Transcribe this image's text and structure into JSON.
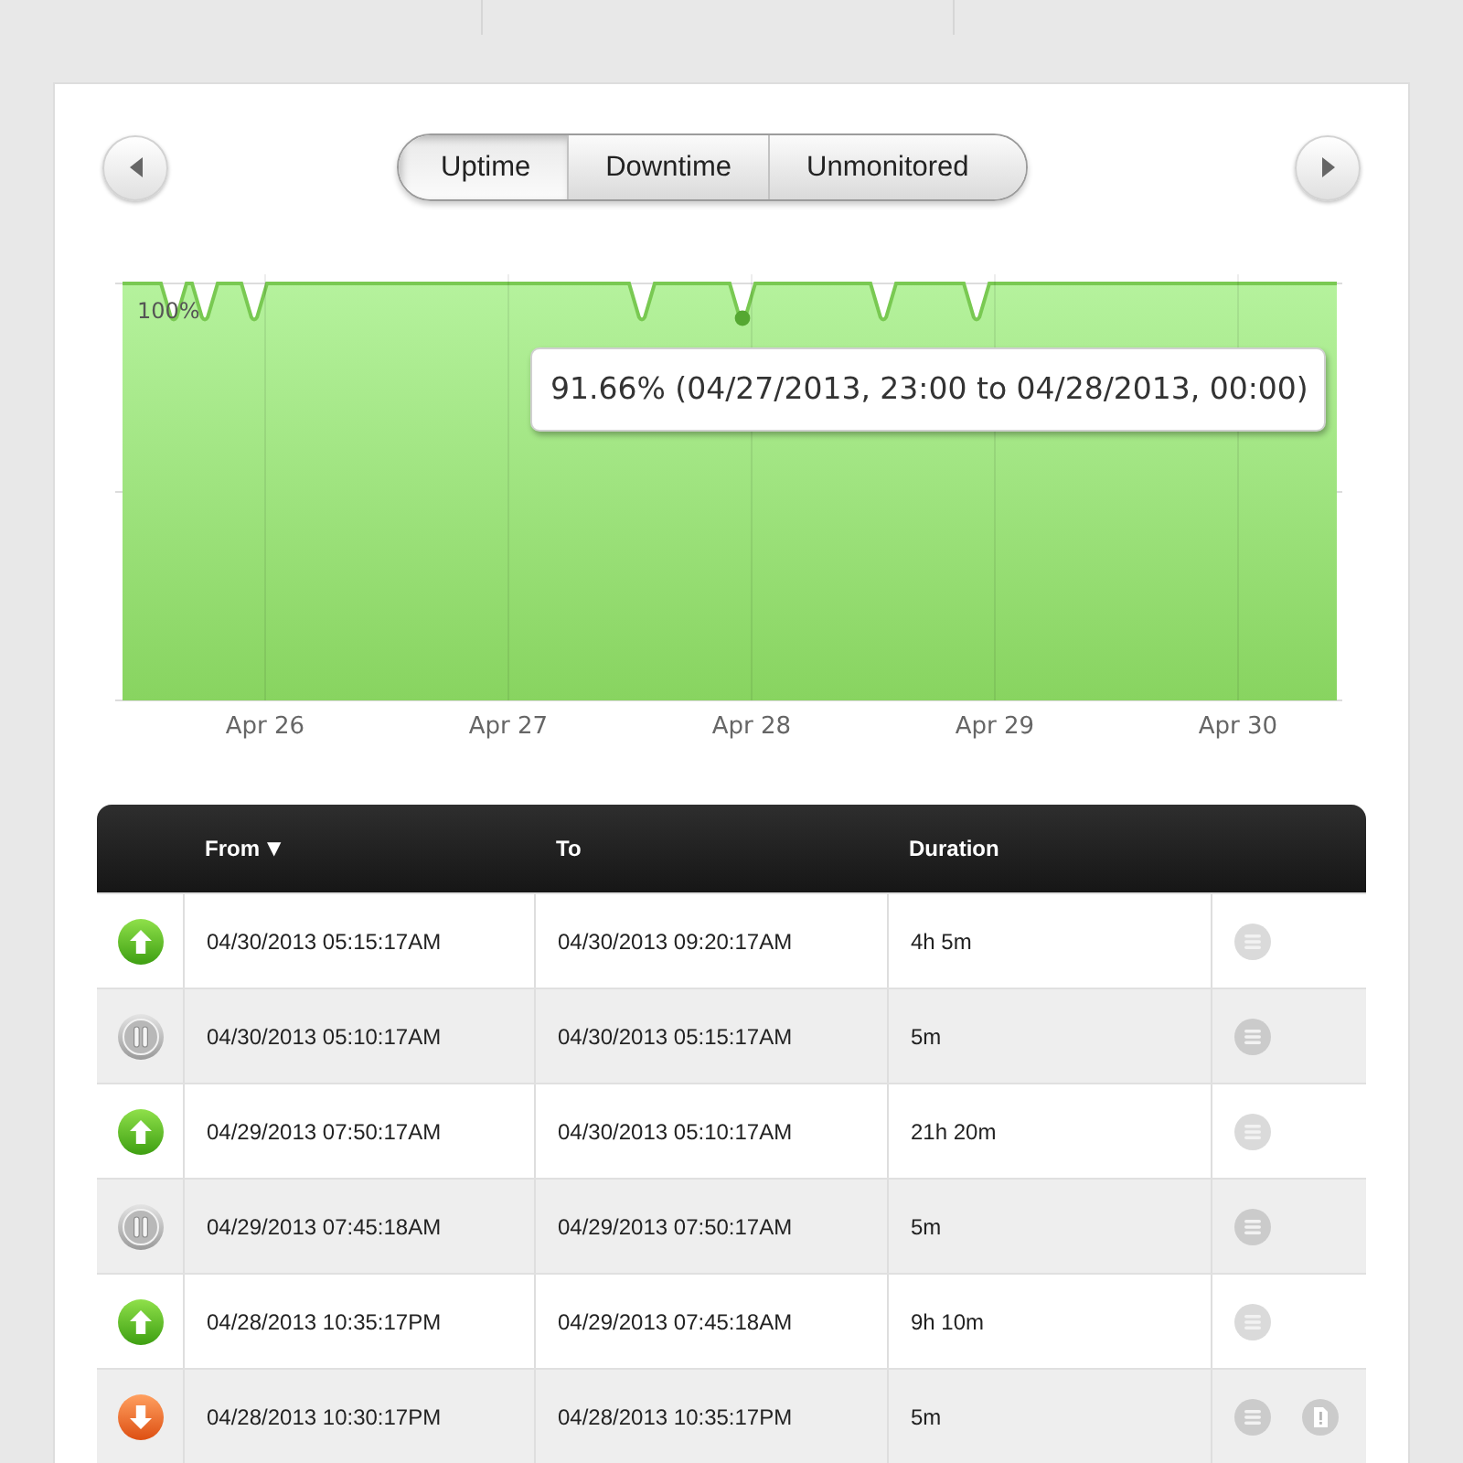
{
  "view_tabs": [
    {
      "label": "Uptime",
      "selected": true
    },
    {
      "label": "Downtime",
      "selected": false
    },
    {
      "label": "Unmonitored",
      "selected": false
    }
  ],
  "chart": {
    "y_label": "100%",
    "x_labels": [
      "Apr 26",
      "Apr 27",
      "Apr 28",
      "Apr 29",
      "Apr 30"
    ],
    "tooltip": "91.66% (04/27/2013, 23:00 to 04/28/2013, 00:00)"
  },
  "table": {
    "columns": [
      {
        "label": "From",
        "sort_icon": "▼"
      },
      {
        "label": "To"
      },
      {
        "label": "Duration"
      }
    ],
    "rows": [
      {
        "kind": "up",
        "from": "04/30/2013 05:15:17AM",
        "to": "04/30/2013 09:20:17AM",
        "duration": "4h 5m",
        "has_note": false
      },
      {
        "kind": "paused",
        "from": "04/30/2013 05:10:17AM",
        "to": "04/30/2013 05:15:17AM",
        "duration": "5m",
        "has_note": false
      },
      {
        "kind": "up",
        "from": "04/29/2013 07:50:17AM",
        "to": "04/30/2013 05:10:17AM",
        "duration": "21h 20m",
        "has_note": false
      },
      {
        "kind": "paused",
        "from": "04/29/2013 07:45:18AM",
        "to": "04/29/2013 07:50:17AM",
        "duration": "5m",
        "has_note": false
      },
      {
        "kind": "up",
        "from": "04/28/2013 10:35:17PM",
        "to": "04/29/2013 07:45:18AM",
        "duration": "9h 10m",
        "has_note": false
      },
      {
        "kind": "down",
        "from": "04/28/2013 10:30:17PM",
        "to": "04/28/2013 10:35:17PM",
        "duration": "5m",
        "has_note": true
      }
    ]
  }
}
